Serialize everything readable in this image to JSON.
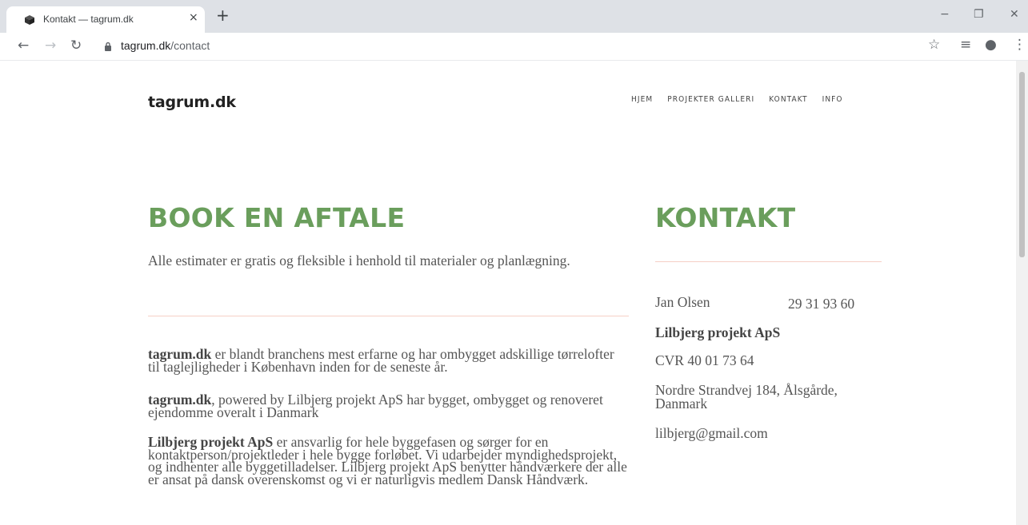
{
  "browser": {
    "tab": {
      "title": "Kontakt — tagrum.dk",
      "close": "×"
    },
    "new_tab": "+",
    "window_controls": {
      "minimize": "−",
      "restore": "❐",
      "close": "✕"
    },
    "nav": {
      "back": "←",
      "forward": "→",
      "reload": "↻"
    },
    "url": {
      "domain": "tagrum.dk",
      "path": "/contact"
    },
    "tools": {
      "star": "☆",
      "media": "≡",
      "profile": "●",
      "menu": "⋮"
    }
  },
  "site": {
    "logo": "tagrum.dk",
    "nav": [
      "HJEM",
      "PROJEKTER GALLERI",
      "KONTAKT",
      "INFO"
    ]
  },
  "main": {
    "heading": "BOOK EN AFTALE",
    "intro": "Alle estimater er gratis og fleksible i henhold til materialer og planlægning.",
    "paragraphs": [
      {
        "bold": "tagrum.dk",
        "text": " er blandt branchens mest erfarne og har ombygget adskillige tørrelofter til taglejligheder i København inden for de seneste år."
      },
      {
        "bold": "tagrum.dk",
        "text": ", powered by Lilbjerg projekt ApS har bygget, ombygget og renoveret ejendomme overalt i Danmark"
      },
      {
        "bold": "Lilbjerg projekt ApS",
        "text": " er ansvarlig for hele byggefasen og sørger for en kontaktperson/projektleder i hele bygge forløbet. Vi udarbejder myndighedsprojekt, og indhenter alle byggetilladelser. Lilbjerg projekt ApS benytter håndværkere der alle er ansat på dansk overenskomst og vi er naturligvis medlem Dansk Håndværk."
      }
    ]
  },
  "contact": {
    "heading": "KONTAKT",
    "name": "Jan Olsen",
    "phone": "29 31 93 60",
    "company": "Lilbjerg projekt ApS",
    "cvr": "CVR 40 01 73 64",
    "address": "Nordre Strandvej 184, Ålsgårde, Danmark",
    "email": "lilbjerg@gmail.com"
  },
  "colors": {
    "accent_green": "#6a9e5c",
    "rule_peach": "#f6cfc6",
    "text": "#555555"
  }
}
